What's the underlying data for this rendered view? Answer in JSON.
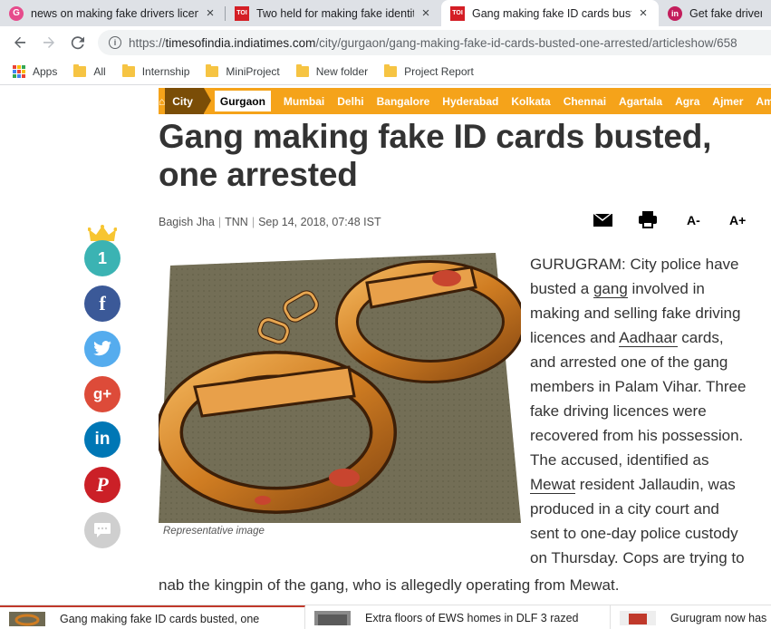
{
  "browser": {
    "tabs": [
      {
        "title": "news on making fake drivers licen",
        "favicon": "google-icon",
        "active": false
      },
      {
        "title": "Two held for making fake identity",
        "favicon": "toi-icon",
        "active": false
      },
      {
        "title": "Gang making fake ID cards buste",
        "favicon": "toi-icon",
        "active": true
      },
      {
        "title": "Get fake driver's l",
        "favicon": "linkedin-icon",
        "active": false
      }
    ],
    "favicon_text": {
      "toi": "TOI",
      "in": "in"
    },
    "tab_close": "×",
    "url_scheme": "https://",
    "url_host": "timesofindia.indiatimes.com",
    "url_path": "/city/gurgaon/gang-making-fake-id-cards-busted-one-arrested/articleshow/658",
    "info_glyph": "i",
    "bookmarks": [
      "Apps",
      "All",
      "Internship",
      "MiniProject",
      "New folder",
      "Project Report"
    ]
  },
  "page": {
    "city_label": "City",
    "home_glyph": "⌂",
    "active_city": "Gurgaon",
    "cities": [
      "Mumbai",
      "Delhi",
      "Bangalore",
      "Hyderabad",
      "Kolkata",
      "Chennai",
      "Agartala",
      "Agra",
      "Ajmer",
      "Amara"
    ],
    "headline_line1": "Gang making fake ID cards busted,",
    "headline_line2": "one arrested",
    "author": "Bagish Jha",
    "agency": "TNN",
    "date": "Sep 14, 2018, 07:48 IST",
    "byline_sep": "|",
    "font_smaller": "A-",
    "font_larger": "A+",
    "share_count": "1",
    "share": {
      "facebook": "f",
      "googleplus": "g+",
      "linkedin": "in",
      "pinterest": "P"
    },
    "caption": "Representative image",
    "body_lines": [
      {
        "pre": "GURUGRAM: City police have",
        "kw": "",
        "post": ""
      },
      {
        "pre": "busted a ",
        "kw": "gang",
        "post": " involved in"
      },
      {
        "pre": "making and selling fake driving",
        "kw": "",
        "post": ""
      },
      {
        "pre": "licences and ",
        "kw": "Aadhaar",
        "post": " cards,"
      },
      {
        "pre": "and arrested one of the gang",
        "kw": "",
        "post": ""
      },
      {
        "pre": "members in Palam Vihar. Three",
        "kw": "",
        "post": ""
      },
      {
        "pre": "fake driving licences were",
        "kw": "",
        "post": ""
      },
      {
        "pre": "recovered from his possession.",
        "kw": "",
        "post": ""
      },
      {
        "pre": "The accused, identified as",
        "kw": "",
        "post": ""
      },
      {
        "pre": "",
        "kw": "Mewat",
        "post": " resident Jallaudin, was"
      },
      {
        "pre": "produced in a city court and",
        "kw": "",
        "post": ""
      },
      {
        "pre": "sent to one-day police custody",
        "kw": "",
        "post": ""
      },
      {
        "pre": "on Thursday. Cops are trying to",
        "kw": "",
        "post": ""
      }
    ],
    "body_last_line": "nab the kingpin of the gang, who is allegedly operating from Mewat."
  },
  "bottom_strip": [
    "Gang making fake ID cards busted, one",
    "Extra floors of EWS homes in DLF 3 razed",
    "Gurugram now has"
  ],
  "colors": {
    "nav_orange": "#f5a31a",
    "city_brown": "#7a4d07",
    "facebook": "#3b5998",
    "twitter": "#55acee",
    "googleplus": "#dd4b39",
    "linkedin": "#0077b5",
    "pinterest": "#cb2027",
    "count_teal": "#3bb3b3"
  }
}
